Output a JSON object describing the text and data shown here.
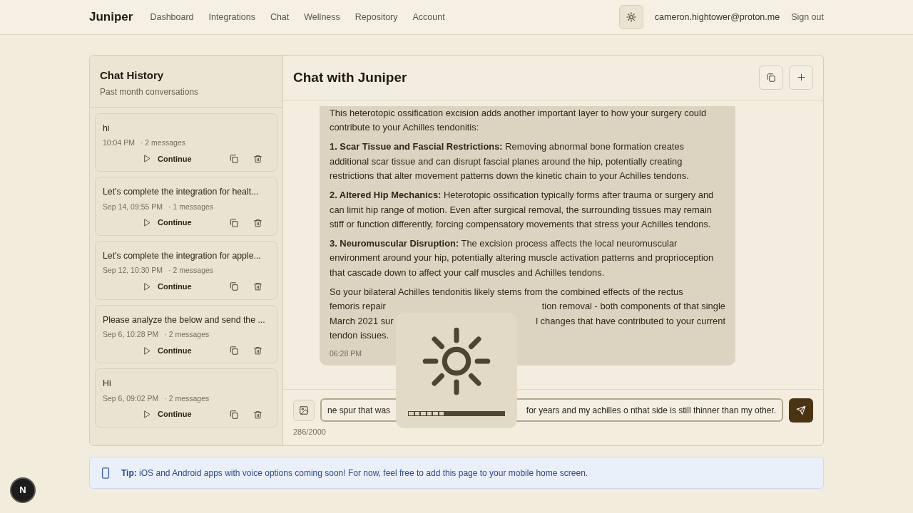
{
  "navbar": {
    "brand": "Juniper",
    "links": [
      {
        "label": "Dashboard",
        "selected": false
      },
      {
        "label": "Integrations",
        "selected": false
      },
      {
        "label": "Chat",
        "selected": false
      },
      {
        "label": "Wellness",
        "selected": false
      },
      {
        "label": "Repository",
        "selected": false
      },
      {
        "label": "Account",
        "selected": false
      }
    ],
    "email": "cameron.hightower@proton.me",
    "sign_out": "Sign out"
  },
  "sidebar": {
    "title": "Chat History",
    "subtitle": "Past month conversations",
    "items": [
      {
        "title": "hi",
        "time": "10:04 PM",
        "count": "· 2 messages",
        "action": "Continue"
      },
      {
        "title": "Let's complete the integration for healt...",
        "time": "Sep 14, 09:55 PM",
        "count": "· 1 messages",
        "action": "Continue"
      },
      {
        "title": "Let's complete the integration for apple...",
        "time": "Sep 12, 10:30 PM",
        "count": "· 2 messages",
        "action": "Continue"
      },
      {
        "title": "Please analyze the below and send the ...",
        "time": "Sep 6, 10:28 PM",
        "count": "· 2 messages",
        "action": "Continue"
      },
      {
        "title": "Hi",
        "time": "Sep 6, 09:02 PM",
        "count": "· 2 messages",
        "action": "Continue"
      }
    ]
  },
  "chat": {
    "title": "Chat with Juniper",
    "message": {
      "paragraphs": [
        "This heterotopic ossification excision adds another important layer to how your surgery could contribute to your Achilles tendonitis:",
        "**1. Scar Tissue and Fascial Restrictions:** Removing abnormal bone formation creates additional scar tissue and can disrupt fascial planes around the hip, potentially creating restrictions that alter movement patterns down the kinetic chain to your Achilles tendons.",
        "**2. Altered Hip Mechanics:** Heterotopic ossification typically forms after trauma or surgery and can limit hip range of motion. Even after surgical removal, the surrounding tissues may remain stiff or function differently, forcing compensatory movements that stress your Achilles tendons.",
        "**3. Neuromuscular Disruption:** The excision process affects the local neuromuscular environment around your hip, potentially altering muscle activation patterns and proprioception that cascade down to affect your calf muscles and Achilles tendons."
      ],
      "covered_lines": [
        [
          "So your bilateral Achilles tendonitis likely stems from the combined effects of the rectus"
        ],
        [
          "femoris repair",
          "tion removal - both components of that single"
        ],
        [
          "March 2021 sur",
          "l changes that have contributed to your current"
        ],
        [
          "tendon issues."
        ]
      ],
      "time": "06:28 PM"
    },
    "input": {
      "value_parts": [
        "ne spur that was",
        "for years and my achilles o nthat side is still thinner than my other."
      ]
    },
    "counter": "286/2000"
  },
  "tip": {
    "label": "Tip:",
    "text": "iOS and Android apps with voice options coming soon! For now, feel free to add this page to your mobile home screen."
  },
  "dev_badge": "N",
  "brightness_hud": {
    "level": 0.375
  }
}
